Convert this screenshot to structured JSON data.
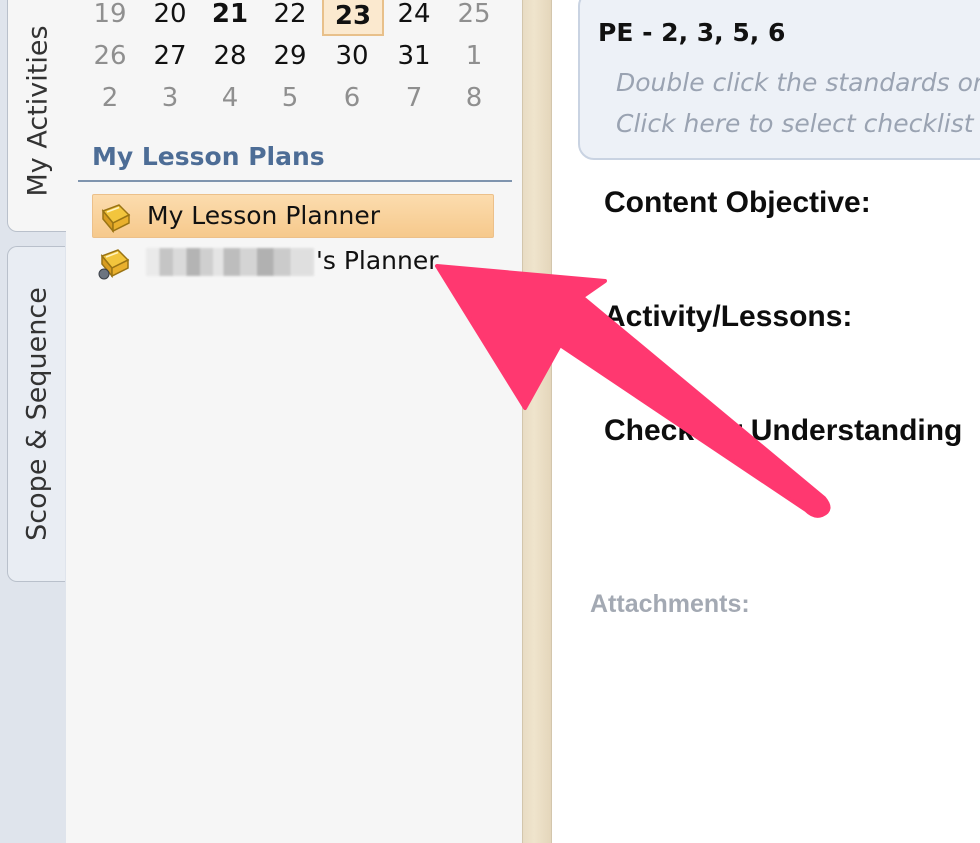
{
  "tabs": [
    {
      "label": "My Activities"
    },
    {
      "label": "Scope & Sequence"
    }
  ],
  "calendar": {
    "weeks": [
      [
        "19",
        "20",
        "21",
        "22",
        "23",
        "24",
        "25"
      ],
      [
        "26",
        "27",
        "28",
        "29",
        "30",
        "31",
        "1"
      ],
      [
        "2",
        "3",
        "4",
        "5",
        "6",
        "7",
        "8"
      ]
    ],
    "selected_day": "23"
  },
  "lesson_plans": {
    "title": "My Lesson Plans",
    "items": [
      {
        "label": "My Lesson Planner",
        "selected": true
      },
      {
        "label_suffix": "'s Planner",
        "selected": false
      }
    ]
  },
  "standards": {
    "title": "PE - 2, 3, 5, 6",
    "hint_line1": "Double click the standards on",
    "hint_line2": "Click here to select checklist i"
  },
  "fields": {
    "content_objective": "Content Objective:",
    "activity_lessons": "Activity/Lessons:",
    "check_understanding": "Check for Understanding"
  },
  "attachments_label": "Attachments:",
  "colors": {
    "section_title": "#4d6d96",
    "selected_item_bg": "#f6c98c",
    "arrow": "#ff3870",
    "hint_text": "#9aa3b2"
  },
  "icons": [
    "book-icon",
    "book-icon"
  ]
}
